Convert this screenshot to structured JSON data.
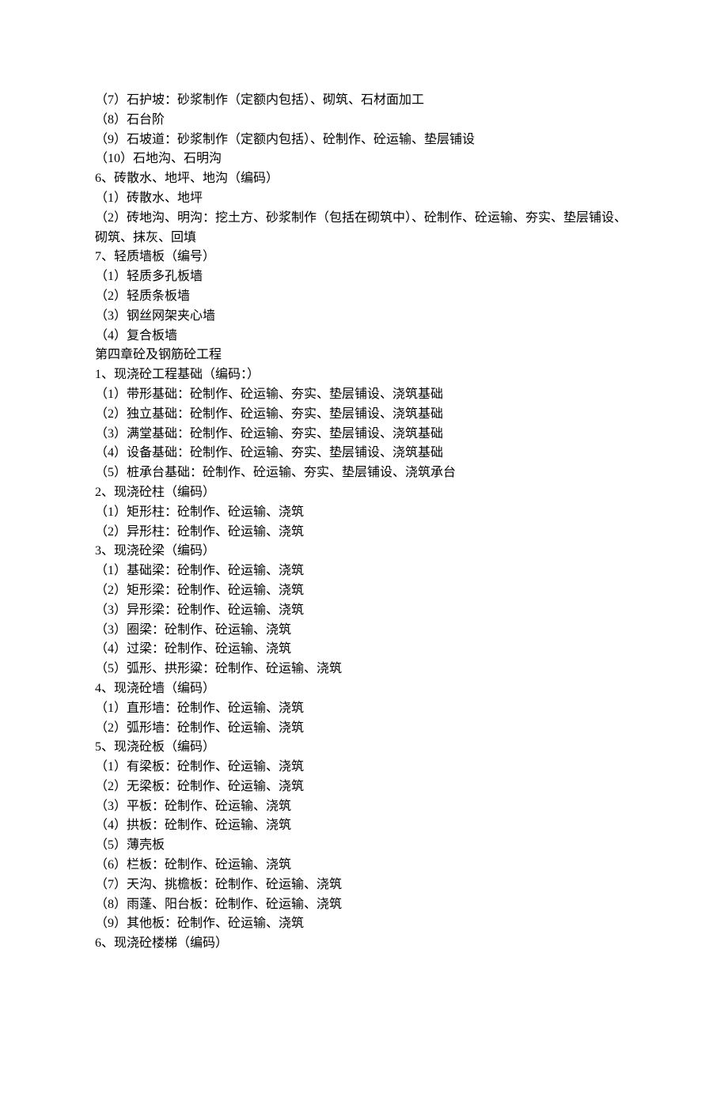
{
  "lines": [
    "（7）石护坡：砂浆制作（定额内包括）、砌筑、石材面加工",
    "（8）石台阶",
    "（9）石坡道：砂浆制作（定额内包括）、砼制作、砼运输、垫层铺设",
    "（10）石地沟、石明沟",
    "6、砖散水、地坪、地沟（编码）",
    "（1）砖散水、地坪",
    "（2）砖地沟、明沟：挖土方、砂浆制作（包括在砌筑中）、砼制作、砼运输、夯实、垫层铺设、砌筑、抹灰、回填",
    "7、轻质墙板（编号）",
    "（1）轻质多孔板墙",
    "（2）轻质条板墙",
    "（3）钢丝网架夹心墙",
    "（4）复合板墙",
    "第四章砼及钢筋砼工程",
    "1、现浇砼工程基础（编码：）",
    "（1）带形基础：砼制作、砼运输、夯实、垫层铺设、浇筑基础",
    "（2）独立基础：砼制作、砼运输、夯实、垫层铺设、浇筑基础",
    "（3）满堂基础：砼制作、砼运输、夯实、垫层铺设、浇筑基础",
    "（4）设备基础：砼制作、砼运输、夯实、垫层铺设、浇筑基础",
    "（5）桩承台基础：砼制作、砼运输、夯实、垫层铺设、浇筑承台",
    "2、现浇砼柱（编码）",
    "（1）矩形柱：砼制作、砼运输、浇筑",
    "（2）异形柱：砼制作、砼运输、浇筑",
    "3、现浇砼梁（编码）",
    "（1）基础梁：砼制作、砼运输、浇筑",
    "（2）矩形梁：砼制作、砼运输、浇筑",
    "（3）异形梁：砼制作、砼运输、浇筑",
    "（3）圈梁：砼制作、砼运输、浇筑",
    "（4）过梁：砼制作、砼运输、浇筑",
    "（5）弧形、拱形粱：砼制作、砼运输、浇筑",
    "4、现浇砼墙（编码）",
    "（1）直形墙：砼制作、砼运输、浇筑",
    "（2）弧形墙：砼制作、砼运输、浇筑",
    "5、现浇砼板（编码）",
    "（1）有梁板：砼制作、砼运输、浇筑",
    "（2）无梁板：砼制作、砼运输、浇筑",
    "（3）平板：砼制作、砼运输、浇筑",
    "（4）拱板：砼制作、砼运输、浇筑",
    "（5）薄壳板",
    "（6）栏板：砼制作、砼运输、浇筑",
    "（7）天沟、挑檐板：砼制作、砼运输、浇筑",
    "（8）雨蓬、阳台板：砼制作、砼运输、浇筑",
    "（9）其他板：砼制作、砼运输、浇筑",
    "6、现浇砼楼梯（编码）"
  ]
}
